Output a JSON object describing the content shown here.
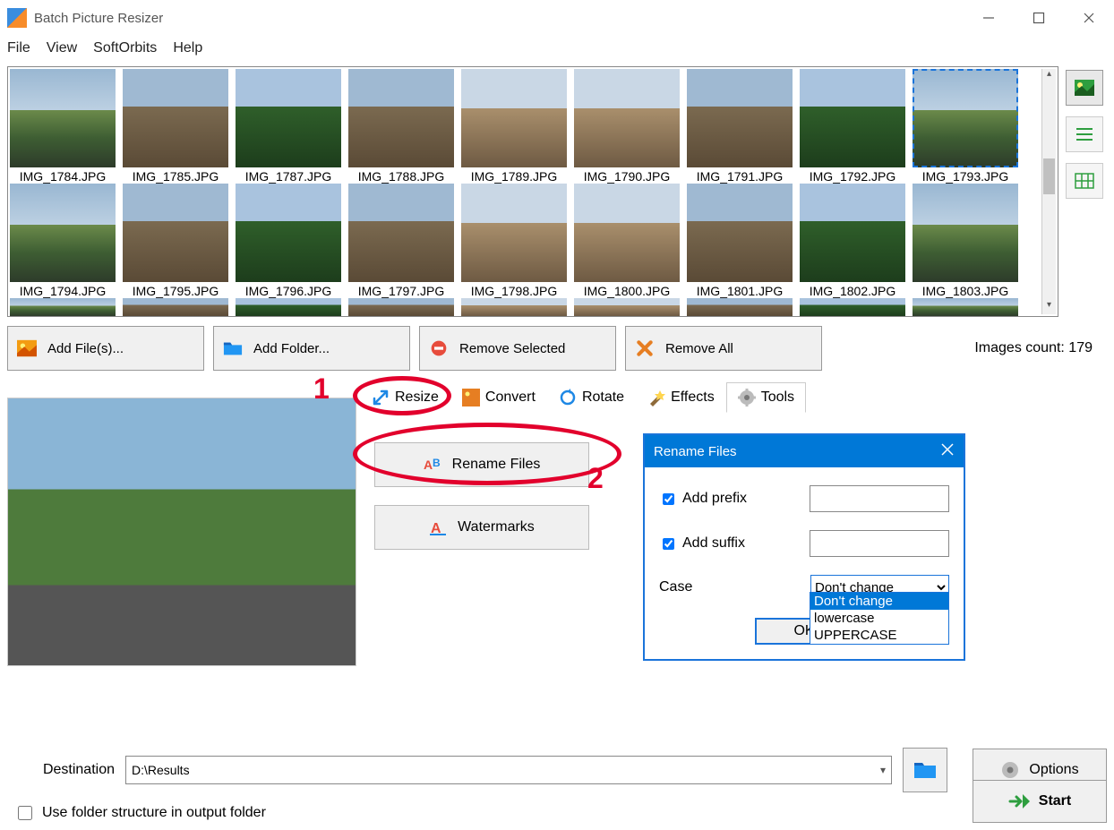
{
  "window": {
    "title": "Batch Picture Resizer"
  },
  "menu": {
    "file": "File",
    "view": "View",
    "softorbits": "SoftOrbits",
    "help": "Help"
  },
  "gallery": {
    "row1": [
      {
        "label": "IMG_1784.JPG"
      },
      {
        "label": "IMG_1785.JPG"
      },
      {
        "label": "IMG_1787.JPG"
      },
      {
        "label": "IMG_1788.JPG"
      },
      {
        "label": "IMG_1789.JPG"
      },
      {
        "label": "IMG_1790.JPG"
      },
      {
        "label": "IMG_1791.JPG"
      },
      {
        "label": "IMG_1792.JPG"
      },
      {
        "label": "IMG_1793.JPG",
        "selected": true
      }
    ],
    "row2": [
      {
        "label": "IMG_1794.JPG"
      },
      {
        "label": "IMG_1795.JPG"
      },
      {
        "label": "IMG_1796.JPG"
      },
      {
        "label": "IMG_1797.JPG"
      },
      {
        "label": "IMG_1798.JPG"
      },
      {
        "label": "IMG_1800.JPG"
      },
      {
        "label": "IMG_1801.JPG"
      },
      {
        "label": "IMG_1802.JPG"
      },
      {
        "label": "IMG_1803.JPG"
      }
    ]
  },
  "actions": {
    "add_files": "Add File(s)...",
    "add_folder": "Add Folder...",
    "remove_selected": "Remove Selected",
    "remove_all": "Remove All",
    "images_count": "Images count: 179"
  },
  "tabs": {
    "resize": "Resize",
    "convert": "Convert",
    "rotate": "Rotate",
    "effects": "Effects",
    "tools": "Tools"
  },
  "tools": {
    "rename_files": "Rename Files",
    "watermarks": "Watermarks"
  },
  "dialog": {
    "title": "Rename Files",
    "add_prefix": "Add prefix",
    "add_suffix": "Add suffix",
    "case_lbl": "Case",
    "case_selected": "Don't change",
    "case_options": [
      "Don't change",
      "lowercase",
      "UPPERCASE"
    ],
    "ok": "OK"
  },
  "bottom": {
    "destination_lbl": "Destination",
    "destination_value": "D:\\Results",
    "use_folder_structure": "Use folder structure in output folder",
    "options": "Options",
    "start": "Start"
  },
  "annotations": {
    "n1": "1",
    "n2": "2"
  }
}
